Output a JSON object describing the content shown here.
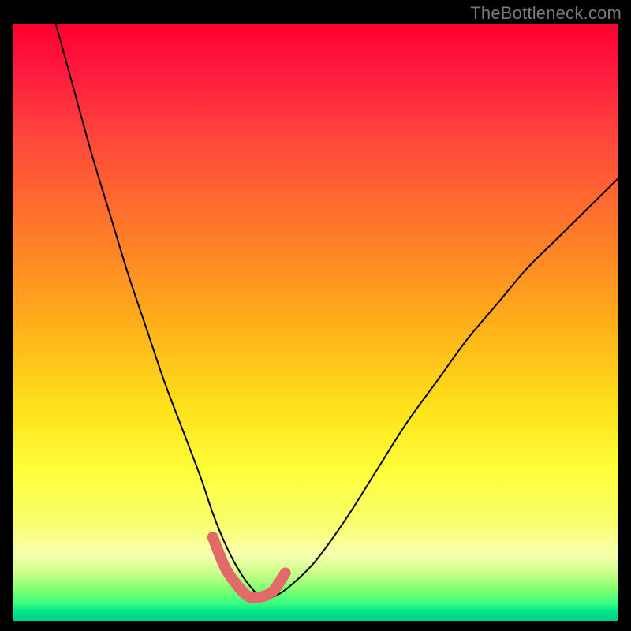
{
  "attribution": "TheBottleneck.com",
  "colors": {
    "page_bg": "#000000",
    "gradient_top": "#ff002e",
    "gradient_bottom": "#00d090",
    "curve_black": "#000000",
    "curve_highlight": "#e26a6a"
  },
  "chart_data": {
    "type": "line",
    "title": "",
    "xlabel": "",
    "ylabel": "",
    "xlim": [
      0,
      100
    ],
    "ylim": [
      0,
      100
    ],
    "series": [
      {
        "name": "bottleneck-curve",
        "x": [
          7,
          10,
          13,
          16,
          19,
          22,
          25,
          28,
          31,
          33,
          35,
          37,
          39,
          41,
          43,
          46,
          50,
          55,
          60,
          65,
          70,
          75,
          80,
          85,
          90,
          95,
          100
        ],
        "values": [
          100,
          89,
          78,
          68,
          58,
          49,
          40,
          32,
          24,
          18,
          13,
          9,
          6,
          4,
          4,
          6,
          10,
          17,
          25,
          33,
          40,
          47,
          53,
          59,
          64,
          69,
          74
        ]
      },
      {
        "name": "highlight-segment",
        "x": [
          33,
          35,
          37,
          39,
          41,
          43,
          45
        ],
        "values": [
          14,
          9,
          6,
          4,
          4,
          5,
          8
        ]
      }
    ]
  }
}
